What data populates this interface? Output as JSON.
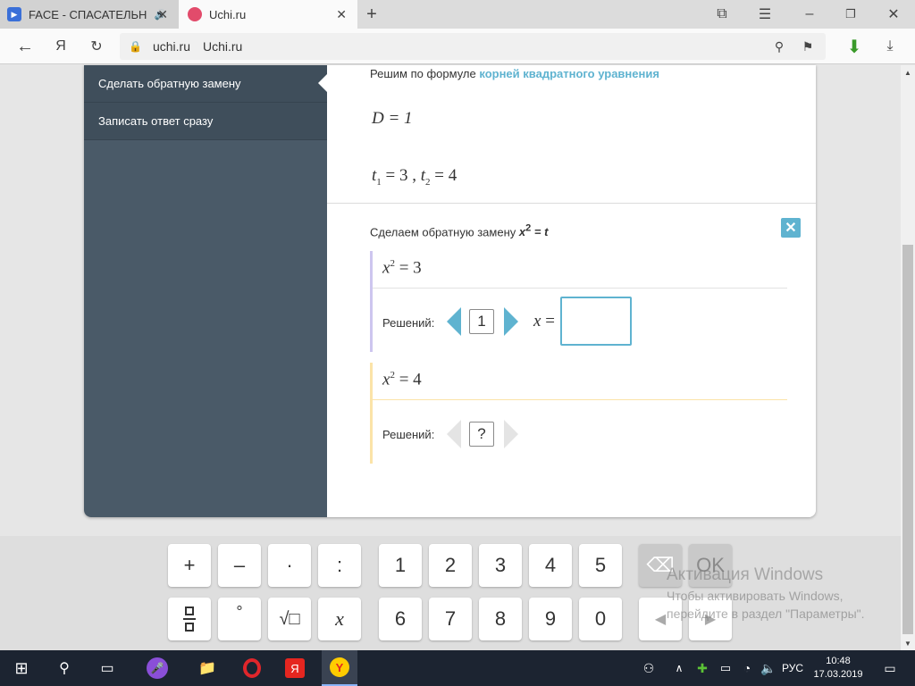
{
  "browser": {
    "tabs": [
      {
        "title": "FACE - СПАСАТЕЛЬН",
        "active": false
      },
      {
        "title": "Uchi.ru",
        "active": true
      }
    ],
    "address": {
      "domain": "uchi.ru",
      "page_title": "Uchi.ru"
    }
  },
  "sidebar": {
    "items": [
      {
        "label": "Сделать обратную замену",
        "active": true
      },
      {
        "label": "Записать ответ сразу",
        "active": false
      }
    ]
  },
  "solution": {
    "formula_prefix": "Решим по формуле",
    "formula_link": "корней квадратного уравнения",
    "discriminant": "D = 1",
    "roots": {
      "t1_label": "t",
      "t1_sub": "1",
      "t1_val": "= 3 ,",
      "t2_label": "t",
      "t2_sub": "2",
      "t2_val": "= 4"
    },
    "substitution_text": "Сделаем обратную замену",
    "substitution_expr": {
      "base": "x",
      "exp": "2",
      "rest": "= t"
    },
    "eq1": {
      "base": "x",
      "exp": "2",
      "rest": "= 3",
      "solutions_label": "Решений:",
      "count": "1",
      "x_label": "x",
      "eq": "=",
      "answer": ""
    },
    "eq2": {
      "base": "x",
      "exp": "2",
      "rest": "= 4",
      "solutions_label": "Решений:",
      "count": "?"
    }
  },
  "keypad": {
    "ops": [
      "+",
      "–",
      "·",
      ":"
    ],
    "specials": [
      "°",
      "√□",
      "x"
    ],
    "digits_row1": [
      "1",
      "2",
      "3",
      "4",
      "5"
    ],
    "digits_row2": [
      "6",
      "7",
      "8",
      "9",
      "0"
    ],
    "ok": "OK",
    "backspace": "⌫",
    "left": "◀",
    "right": "▶"
  },
  "watermark": {
    "title": "Активация Windows",
    "line1": "Чтобы активировать Windows,",
    "line2": "перейдите в раздел \"Параметры\"."
  },
  "taskbar": {
    "lang": "РУС",
    "time": "10:48",
    "date": "17.03.2019"
  },
  "colors": {
    "accent": "#5fb3d0",
    "sidebar": "#4a5a68",
    "taskbar": "#1c2431"
  }
}
